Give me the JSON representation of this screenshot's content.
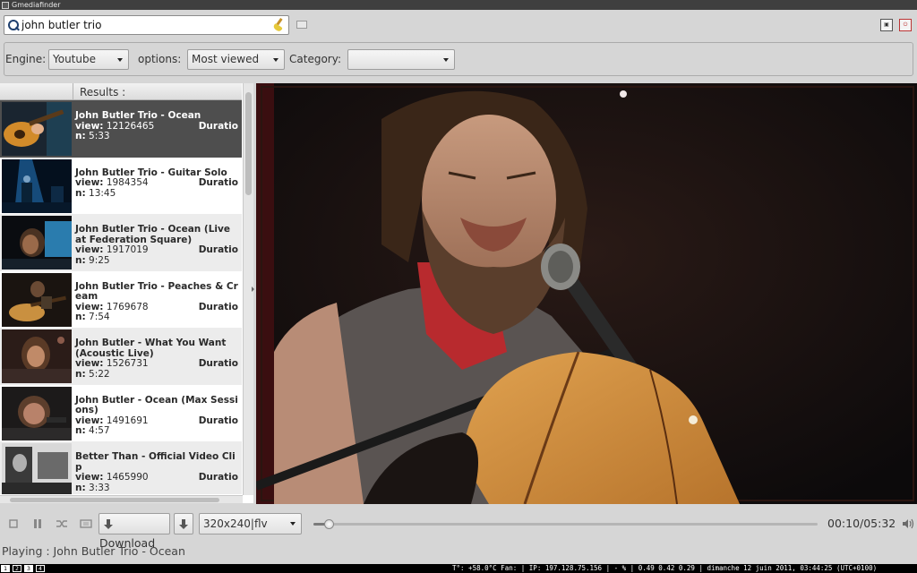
{
  "window": {
    "title": "Gmediafinder"
  },
  "search": {
    "value": "john butler trio"
  },
  "options": {
    "engine_label": "Engine:",
    "engine_value": "Youtube",
    "options_label": "options:",
    "options_value": "Most viewed",
    "category_label": "Category:",
    "category_value": ""
  },
  "results": {
    "header": "Results :",
    "view_label": "view:",
    "duration_label": "Duratio",
    "duration_wrap": "n:",
    "items": [
      {
        "title": "John Butler Trio - Ocean",
        "views": "12126465",
        "duration": "5:33"
      },
      {
        "title": "John Butler Trio - Guitar Solo",
        "views": "1984354",
        "duration": "13:45"
      },
      {
        "title": "John Butler Trio - Ocean (Live at Federation Square)",
        "views": "1917019",
        "duration": "9:25"
      },
      {
        "title": "John Butler Trio - Peaches & Cream",
        "views": "1769678",
        "duration": "7:54"
      },
      {
        "title": "John Butler - What You Want (Acoustic Live)",
        "views": "1526731",
        "duration": "5:22"
      },
      {
        "title": "John Butler - Ocean (Max Sessions)",
        "views": "1491691",
        "duration": "4:57"
      },
      {
        "title": "Better Than - Official Video Clip",
        "views": "1465990",
        "duration": "3:33"
      }
    ]
  },
  "controls": {
    "download_label": "Download",
    "quality_value": "320x240|flv",
    "time": "00:10/05:32",
    "progress": 0.031
  },
  "status": {
    "text": "Playing : John Butler Trio - Ocean"
  },
  "taskbar": {
    "workspaces": [
      "1",
      "2",
      "3",
      "4"
    ],
    "info": "T°: +58.0°C Fan: | IP: 197.128.75.156 | - % | 0.49 0.42 0.29 | dimanche 12 juin 2011, 03:44:25 (UTC+0100)"
  },
  "colors": {
    "selected_row": "#4e4e4e",
    "video_bg": "#0c0a0b"
  }
}
